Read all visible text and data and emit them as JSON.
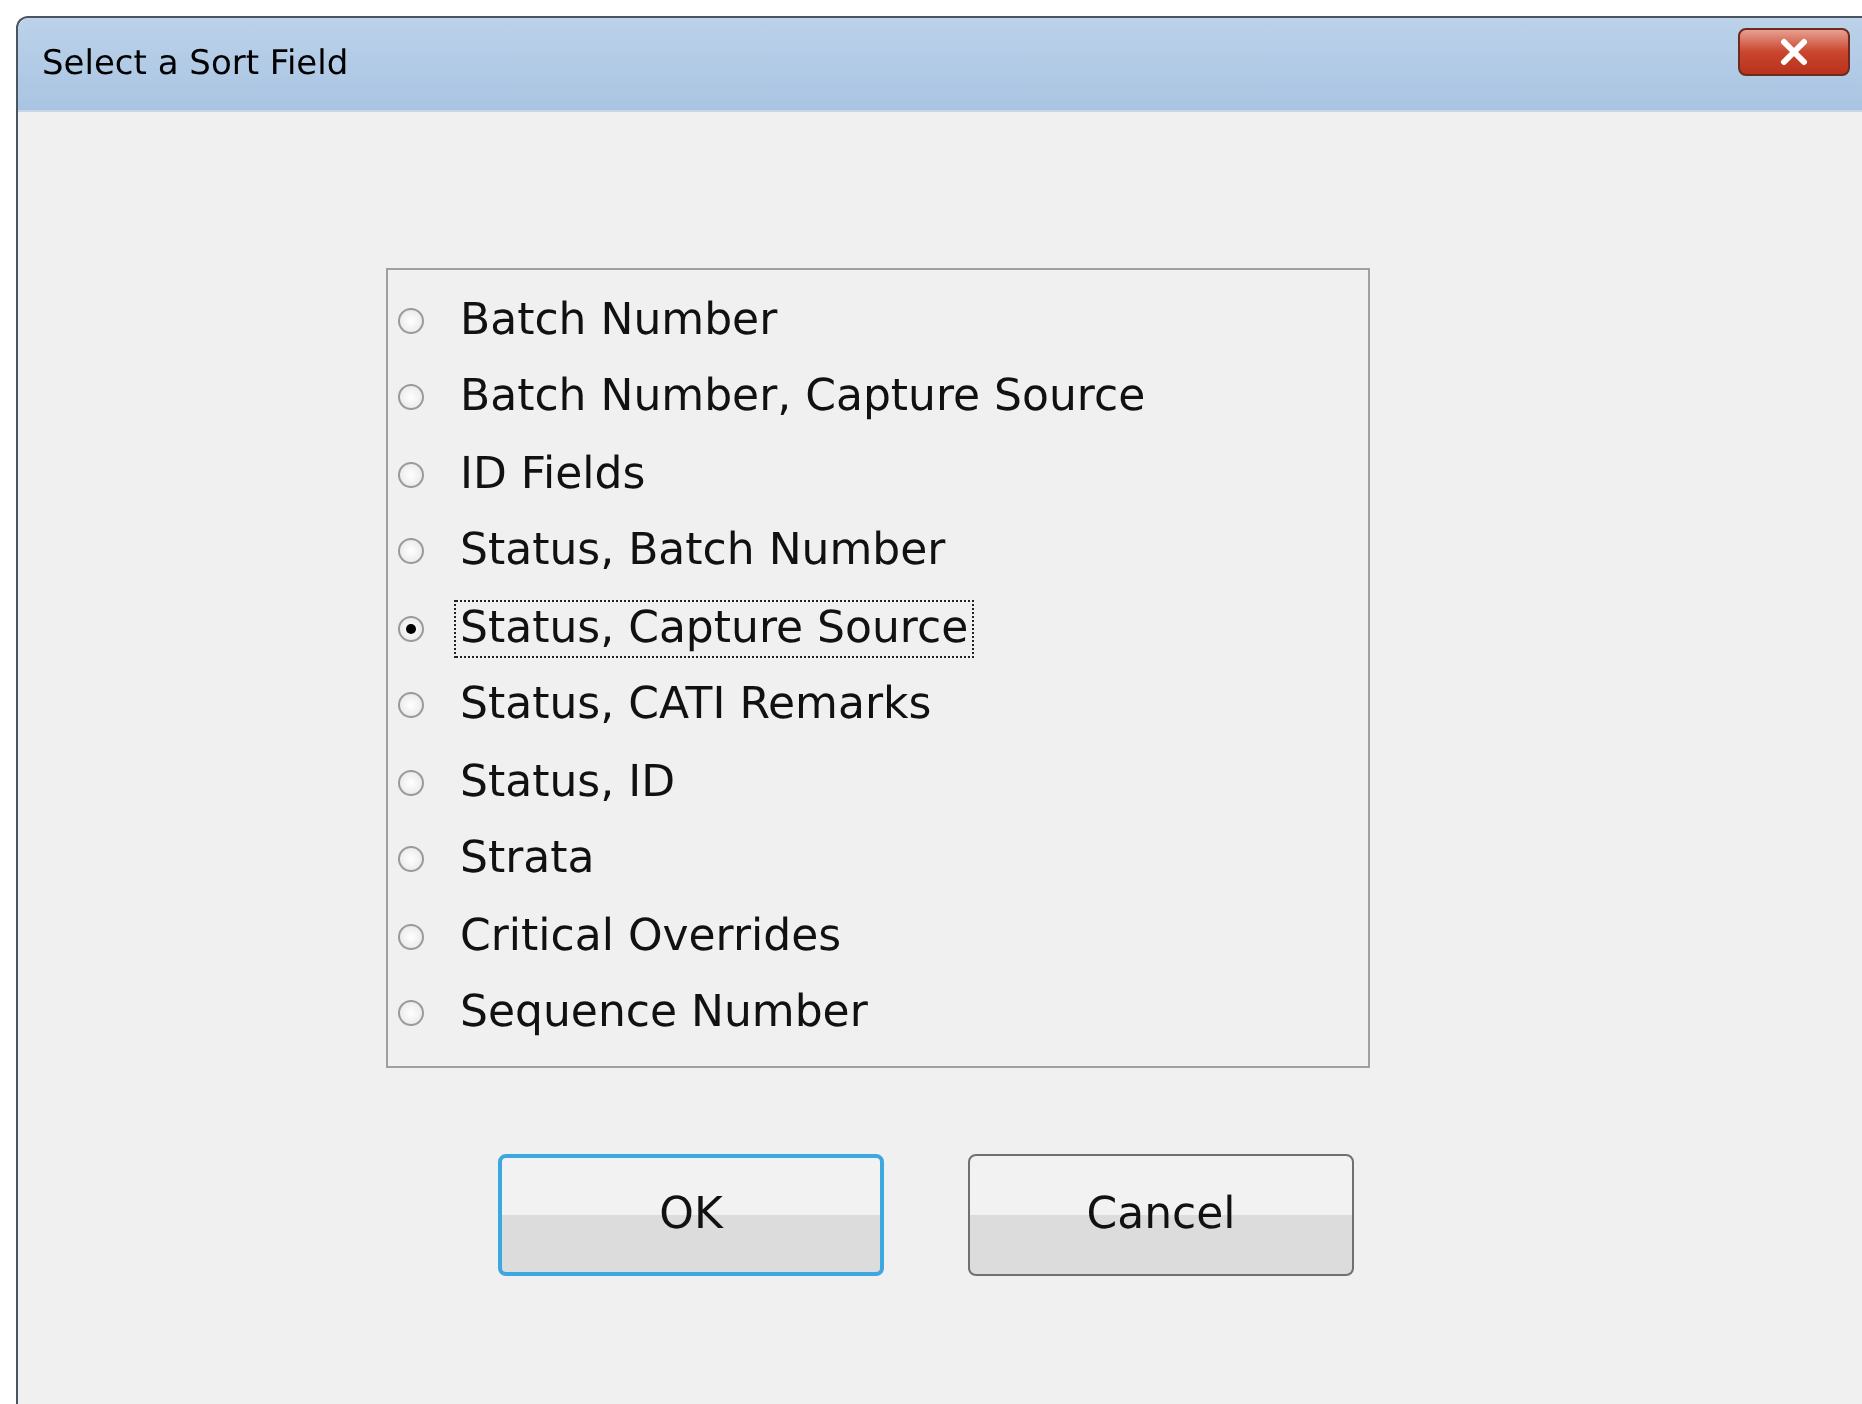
{
  "window": {
    "title": "Select a Sort Field"
  },
  "options": [
    {
      "label": "Batch Number",
      "selected": false
    },
    {
      "label": "Batch Number, Capture Source",
      "selected": false
    },
    {
      "label": "ID Fields",
      "selected": false
    },
    {
      "label": "Status, Batch Number",
      "selected": false
    },
    {
      "label": "Status, Capture Source",
      "selected": true
    },
    {
      "label": "Status, CATI Remarks",
      "selected": false
    },
    {
      "label": "Status, ID",
      "selected": false
    },
    {
      "label": "Strata",
      "selected": false
    },
    {
      "label": "Critical Overrides",
      "selected": false
    },
    {
      "label": "Sequence Number",
      "selected": false
    }
  ],
  "buttons": [
    {
      "label": "OK",
      "default": true
    },
    {
      "label": "Cancel",
      "default": false
    }
  ]
}
